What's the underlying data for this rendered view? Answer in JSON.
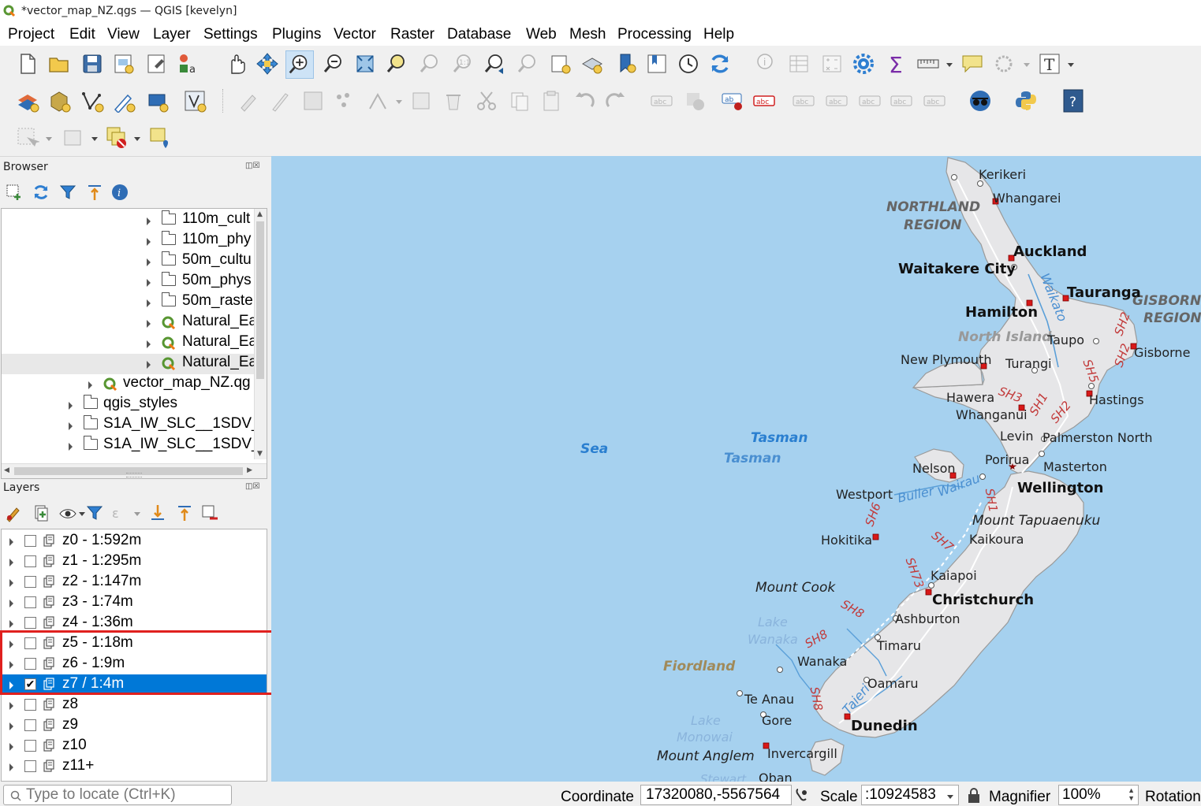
{
  "window": {
    "title": "*vector_map_NZ.qgs — QGIS [kevelyn]"
  },
  "menu": [
    "Project",
    "Edit",
    "View",
    "Layer",
    "Settings",
    "Plugins",
    "Vector",
    "Raster",
    "Database",
    "Web",
    "Mesh",
    "Processing",
    "Help"
  ],
  "browser": {
    "title": "Browser",
    "items": [
      "110m_cult",
      "110m_phy",
      "50m_cultu",
      "50m_phys",
      "50m_raste",
      "Natural_Ea",
      "Natural_Ea",
      "Natural_Ea",
      "vector_map_NZ.qg",
      "qgis_styles",
      "S1A_IW_SLC__1SDV_",
      "S1A_IW_SLC__1SDV_"
    ]
  },
  "layers": {
    "title": "Layers",
    "items": [
      {
        "name": "z0 - 1:592m",
        "checked": false
      },
      {
        "name": "z1 - 1:295m",
        "checked": false
      },
      {
        "name": "z2 - 1:147m",
        "checked": false
      },
      {
        "name": "z3 - 1:74m",
        "checked": false
      },
      {
        "name": "z4 - 1:36m",
        "checked": false
      },
      {
        "name": "z5 - 1:18m",
        "checked": false
      },
      {
        "name": "z6 - 1:9m",
        "checked": false
      },
      {
        "name": "z7 / 1:4m",
        "checked": true,
        "selected": true
      },
      {
        "name": "z8",
        "checked": false
      },
      {
        "name": "z9",
        "checked": false
      },
      {
        "name": "z10",
        "checked": false
      },
      {
        "name": "z11+",
        "checked": false
      }
    ]
  },
  "map": {
    "sea": [
      "Tasman",
      "Sea"
    ],
    "regions": [
      "NORTHLAND",
      "REGION",
      "GISBORN",
      "REGION",
      "North Island",
      "Fiordland"
    ],
    "cities": [
      "Kerikeri",
      "Whangarei",
      "Auckland",
      "Waitakere City",
      "Tauranga",
      "Hamilton",
      "Taupo",
      "Gisborne",
      "New Plymouth",
      "Turangi",
      "Hawera",
      "Hastings",
      "Whanganui",
      "Levin",
      "Palmerston North",
      "Porirua",
      "Masterton",
      "Nelson",
      "Wellington",
      "Westport",
      "Kaikoura",
      "Hokitika",
      "Kaiapoi",
      "Christchurch",
      "Ashburton",
      "Timaru",
      "Wanaka",
      "Oamaru",
      "Te Anau",
      "Gore",
      "Dunedin",
      "Invercargill",
      "Oban"
    ],
    "rivers": [
      "Waikato",
      "Buller",
      "Wairau",
      "Taieri",
      "Lake",
      "Wanaka",
      "Lake",
      "Monowai",
      "Stewart"
    ],
    "roads": [
      "SH2",
      "SH2",
      "SH5",
      "SH3",
      "SH1",
      "SH2",
      "SH1",
      "SH6",
      "SH7",
      "SH73",
      "SH8",
      "SH8",
      "SH8"
    ],
    "mountains": [
      "Mount Tapuaenuku",
      "Mount Cook",
      "Mount Anglem"
    ]
  },
  "status": {
    "locator_placeholder": "Type to locate (Ctrl+K)",
    "coordinate_label": "Coordinate",
    "coordinate_value": "17320080,-5567564",
    "scale_label": "Scale",
    "scale_value": ":10924583",
    "magnifier_label": "Magnifier",
    "magnifier_value": "100%",
    "rotation_label": "Rotation"
  }
}
